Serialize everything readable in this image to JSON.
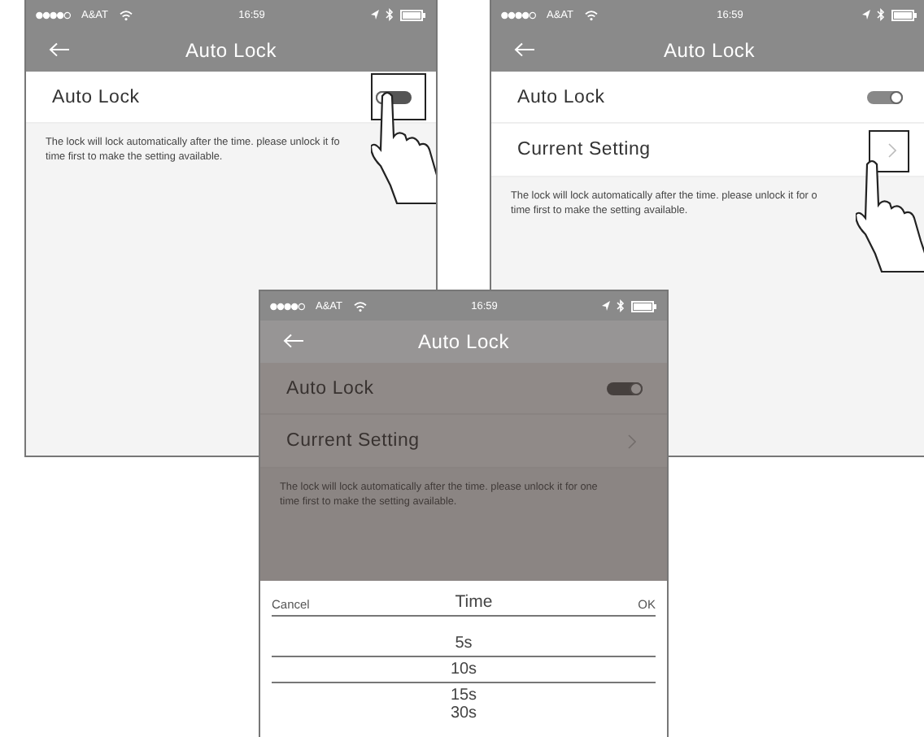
{
  "screens": [
    {
      "status_bar": {
        "carrier": "A&AT",
        "time": "16:59"
      },
      "title": "Auto Lock",
      "rows": [
        {
          "kind": "toggle",
          "label": "Auto Lock",
          "on": false,
          "tapped": true
        }
      ],
      "note": "The lock will lock automatically after the time. please unlock it fo",
      "note_more": "time first to make the setting available."
    },
    {
      "status_bar": {
        "carrier": "A&AT",
        "time": "16:59"
      },
      "title": "Auto Lock",
      "rows": [
        {
          "kind": "toggle",
          "label": "Auto Lock",
          "on": true,
          "tapped": false
        },
        {
          "kind": "link",
          "label": "Current Setting",
          "tapped": true
        }
      ],
      "note": "The lock will lock automatically after the time. please unlock it for o",
      "note_more": "time first to make the setting available."
    },
    {
      "status_bar": {
        "carrier": "A&AT",
        "time": "16:59"
      },
      "title": "Auto Lock",
      "dimmed": true,
      "rows": [
        {
          "kind": "toggle",
          "label": "Auto Lock",
          "on": true,
          "tapped": false
        },
        {
          "kind": "link",
          "label": "Current Setting",
          "tapped": false
        }
      ],
      "note": "The lock will lock automatically after the time. please unlock it for one",
      "note_more": "time first to make the setting available.",
      "picker": {
        "cancel": "Cancel",
        "title": "Time",
        "ok": "OK",
        "options": [
          {
            "label": "5s",
            "selected": false
          },
          {
            "label": "10s",
            "selected": true
          },
          {
            "label": "15s",
            "selected": false
          },
          {
            "label": "30s",
            "selected": false
          }
        ]
      }
    }
  ]
}
